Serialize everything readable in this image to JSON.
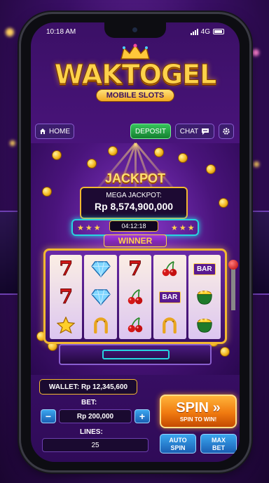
{
  "status": {
    "time": "10:18 AM",
    "network": "4G"
  },
  "logo": {
    "title": "WAKTOGEL",
    "subtitle": "MOBILE SLOTS"
  },
  "nav": {
    "home": "HOME",
    "deposit": "DEPOSIT",
    "chat": "CHAT"
  },
  "jackpot": {
    "title": "JACKPOT",
    "label": "MEGA JACKPOT:",
    "amount": "Rp 8,574,900,000",
    "timer": "04:12:18",
    "winner": "WINNER"
  },
  "reels": [
    [
      "seven",
      "seven",
      "star"
    ],
    [
      "diamond",
      "diamond",
      "horseshoe"
    ],
    [
      "seven",
      "cherry",
      "cherry"
    ],
    [
      "cherry",
      "bar",
      "horseshoe"
    ],
    [
      "bar",
      "pot-of-gold",
      "pot-of-gold"
    ]
  ],
  "symbols": {
    "seven": "7",
    "bar": "BAR"
  },
  "wallet": {
    "text": "WALLET: Rp 12,345,600"
  },
  "bet": {
    "label": "BET:",
    "value": "Rp 200,000",
    "minus": "−",
    "plus": "+"
  },
  "lines": {
    "label": "LINES:",
    "value": "25"
  },
  "spin": {
    "label": "SPIN",
    "sub": "SPIN TO WIN!"
  },
  "auto_spin": {
    "line1": "AUTO",
    "line2": "SPIN"
  },
  "max_bet": {
    "line1": "MAX",
    "line2": "BET"
  },
  "colors": {
    "accent": "#f2b830",
    "deposit": "#14802f",
    "spin": "#f07a10",
    "neon": "#27d4e0"
  }
}
